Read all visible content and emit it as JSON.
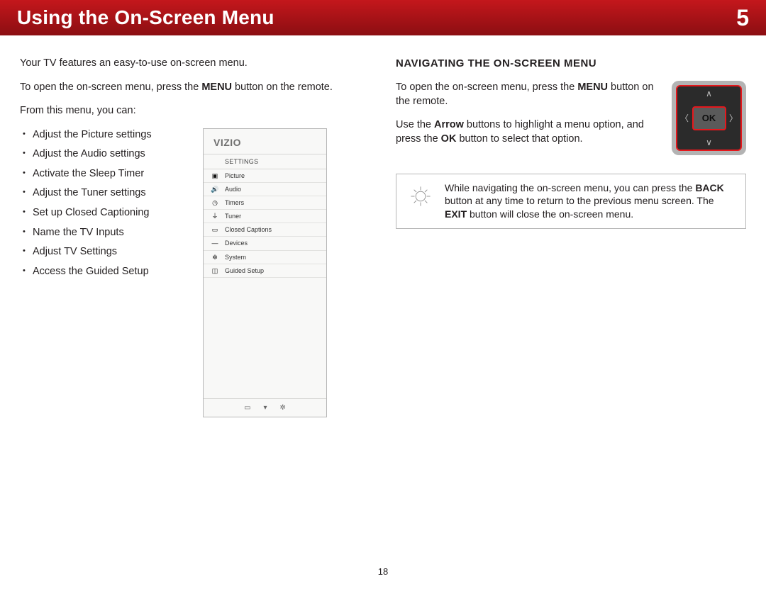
{
  "header": {
    "title": "Using the On-Screen Menu",
    "chapter": "5"
  },
  "left": {
    "intro": "Your TV features an easy-to-use on-screen menu.",
    "open_pre": "To open the on-screen menu, press the ",
    "open_bold": "MENU",
    "open_post": " button on the remote.",
    "from": "From this menu, you can:",
    "bullets": [
      "Adjust the Picture settings",
      "Adjust the Audio settings",
      "Activate the Sleep Timer",
      "Adjust the Tuner settings",
      "Set up Closed Captioning",
      "Name the TV Inputs",
      "Adjust TV Settings",
      "Access the Guided Setup"
    ]
  },
  "osd": {
    "logo": "VIZIO",
    "heading": "SETTINGS",
    "rows": [
      {
        "icon": "picture-icon",
        "glyph": "▣",
        "label": "Picture"
      },
      {
        "icon": "audio-icon",
        "glyph": "🔊",
        "label": "Audio"
      },
      {
        "icon": "timers-icon",
        "glyph": "◷",
        "label": "Timers"
      },
      {
        "icon": "tuner-icon",
        "glyph": "⏚",
        "label": "Tuner"
      },
      {
        "icon": "cc-icon",
        "glyph": "▭",
        "label": "Closed Captions"
      },
      {
        "icon": "devices-icon",
        "glyph": "—",
        "label": "Devices"
      },
      {
        "icon": "system-icon",
        "glyph": "✲",
        "label": "System"
      },
      {
        "icon": "guided-icon",
        "glyph": "◫",
        "label": "Guided Setup"
      }
    ],
    "footer": {
      "wide": "▭",
      "2d": "▾",
      "gear": "✲"
    }
  },
  "right": {
    "heading": "NAVIGATING THE ON-SCREEN MENU",
    "p1_pre": "To open the on-screen menu, press the ",
    "p1_bold": "MENU",
    "p1_post": " button on the remote.",
    "p2_pre": "Use the ",
    "p2_b1": "Arrow",
    "p2_mid": " buttons to highlight a menu option, and press the ",
    "p2_b2": "OK",
    "p2_post": " button to select that option.",
    "tip_pre": "While navigating the on-screen menu, you can press the ",
    "tip_b1": "BACK",
    "tip_mid": " button at any time to return to the previous menu screen. The ",
    "tip_b2": "EXIT",
    "tip_post": " button will close the on-screen menu."
  },
  "remote": {
    "ok": "OK"
  },
  "pageNumber": "18"
}
